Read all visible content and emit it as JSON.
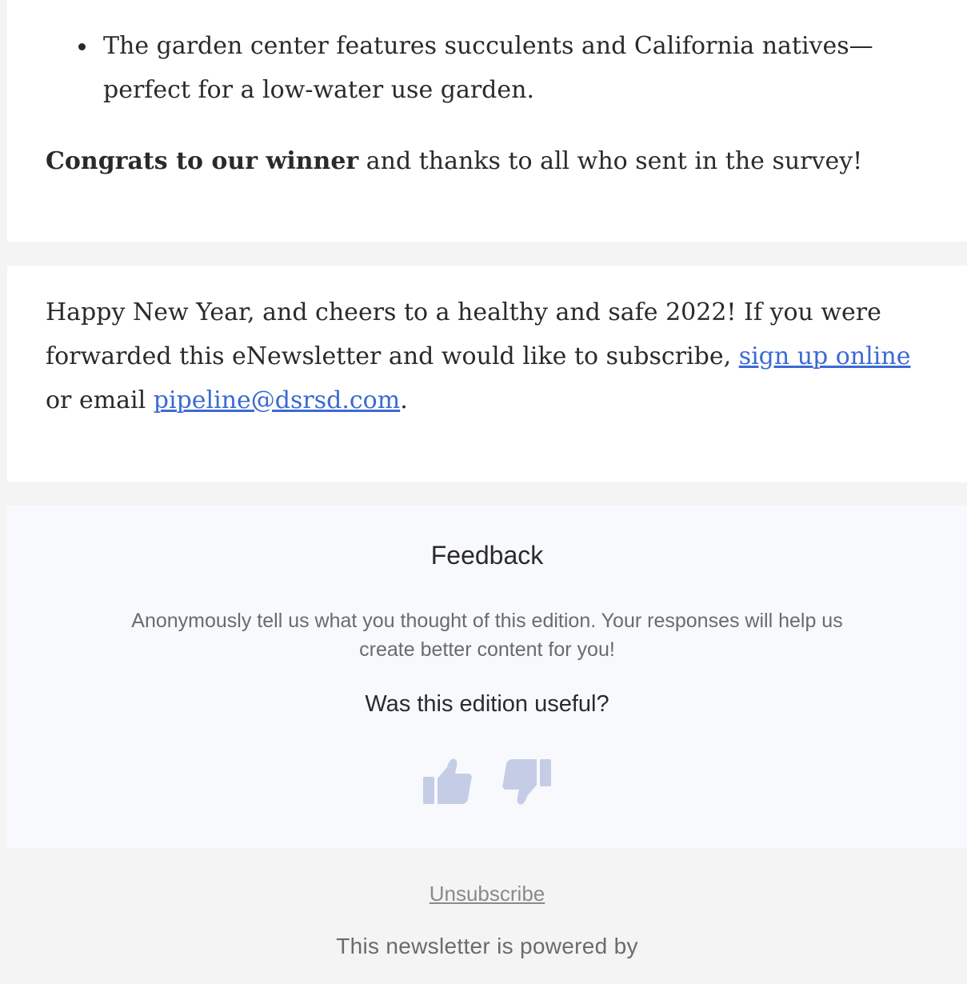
{
  "article": {
    "bullet": "The garden center features succulents and California natives—perfect for a low-water use garden.",
    "congrats_bold": "Congrats to our winner",
    "congrats_rest": " and thanks to all who sent in the survey!"
  },
  "closing": {
    "text_1": "Happy New Year, and cheers to a healthy and safe 2022! If you were forwarded this eNewsletter and would like to subscribe, ",
    "link_signup": "sign up online",
    "text_2": " or email ",
    "link_email": "pipeline@dsrsd.com",
    "text_3": "."
  },
  "feedback": {
    "title": "Feedback",
    "description": "Anonymously tell us what you thought of this edition. Your responses will help us create better content for you!",
    "question": "Was this edition useful?",
    "thumb_color": "#c5cde6"
  },
  "footer": {
    "unsubscribe": "Unsubscribe",
    "powered_by": "This newsletter is powered by"
  }
}
